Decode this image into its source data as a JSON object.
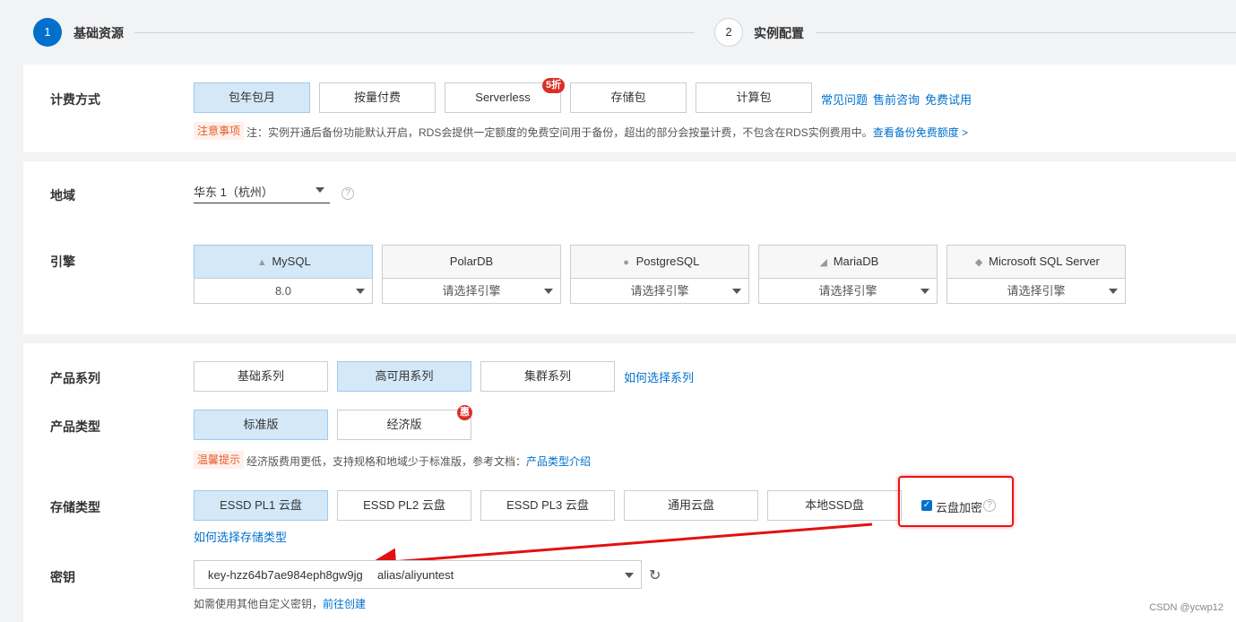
{
  "steps": [
    {
      "number": "1",
      "label": "基础资源"
    },
    {
      "number": "2",
      "label": "实例配置"
    }
  ],
  "billing": {
    "label": "计费方式",
    "options": [
      "包年包月",
      "按量付费",
      "Serverless",
      "存储包",
      "计算包"
    ],
    "selected": "包年包月",
    "serverless_badge": "5折",
    "links": [
      "常见问题",
      "售前咨询",
      "免费试用"
    ],
    "note_tag": "注意事项",
    "note_text": "注：实例开通后备份功能默认开启，RDS会提供一定额度的免费空间用于备份，超出的部分会按量计费，不包含在RDS实例费用中。",
    "note_link": "查看备份免费额度 >"
  },
  "region": {
    "label": "地域",
    "value": "华东 1（杭州）",
    "help": "?"
  },
  "engine": {
    "label": "引擎",
    "options": [
      {
        "name": "MySQL",
        "version": "8.0",
        "icon": "mysql-dolphin-icon"
      },
      {
        "name": "PolarDB",
        "version": "请选择引擎",
        "icon": ""
      },
      {
        "name": "PostgreSQL",
        "version": "请选择引擎",
        "icon": "postgresql-elephant-icon"
      },
      {
        "name": "MariaDB",
        "version": "请选择引擎",
        "icon": "mariadb-seal-icon"
      },
      {
        "name": "Microsoft SQL Server",
        "version": "请选择引擎",
        "icon": "sqlserver-icon"
      }
    ],
    "selected": "MySQL"
  },
  "series": {
    "label": "产品系列",
    "options": [
      "基础系列",
      "高可用系列",
      "集群系列"
    ],
    "selected": "高可用系列",
    "link": "如何选择系列"
  },
  "product_type": {
    "label": "产品类型",
    "options": [
      "标准版",
      "经济版"
    ],
    "selected": "标准版",
    "economy_badge": "惠",
    "tip_tag": "温馨提示",
    "tip_text": "经济版费用更低，支持规格和地域少于标准版，参考文档：",
    "tip_link": "产品类型介绍"
  },
  "storage": {
    "label": "存储类型",
    "options": [
      "ESSD PL1 云盘",
      "ESSD PL2 云盘",
      "ESSD PL3 云盘",
      "通用云盘",
      "本地SSD盘"
    ],
    "selected": "ESSD PL1 云盘",
    "encrypt_label": "云盘加密",
    "encrypt_checked": true,
    "link": "如何选择存储类型"
  },
  "key": {
    "label": "密钥",
    "key_id": "key-hzz64b7ae984eph8gw9jg",
    "alias": "alias/aliyuntest",
    "hint": "如需使用其他自定义密钥，",
    "hint_link": "前往创建"
  },
  "watermark": "CSDN @ycwp12",
  "colors": {
    "accent": "#0070cc",
    "selected_bg": "#d4e8f8",
    "annotation": "#e11111"
  }
}
